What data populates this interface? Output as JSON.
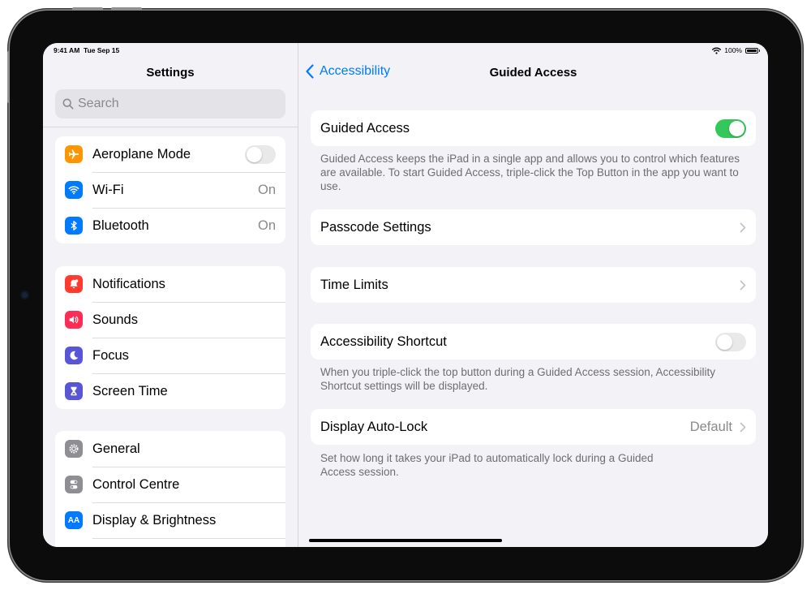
{
  "status": {
    "time": "9:41 AM",
    "date": "Tue Sep 15",
    "battery": "100%"
  },
  "sidebar": {
    "title": "Settings",
    "search_placeholder": "Search",
    "group1": [
      {
        "label": "Aeroplane Mode",
        "icon": "airplane-icon",
        "color": "#ff9500",
        "toggle": false
      },
      {
        "label": "Wi-Fi",
        "icon": "wifi-icon",
        "color": "#007aff",
        "value": "On"
      },
      {
        "label": "Bluetooth",
        "icon": "bluetooth-icon",
        "color": "#007aff",
        "value": "On"
      }
    ],
    "group2": [
      {
        "label": "Notifications",
        "icon": "bell-icon",
        "color": "#ff3b30"
      },
      {
        "label": "Sounds",
        "icon": "speaker-icon",
        "color": "#ff2d55"
      },
      {
        "label": "Focus",
        "icon": "moon-icon",
        "color": "#5856d6"
      },
      {
        "label": "Screen Time",
        "icon": "hourglass-icon",
        "color": "#5856d6"
      }
    ],
    "group3": [
      {
        "label": "General",
        "icon": "gear-icon",
        "color": "#8e8e93"
      },
      {
        "label": "Control Centre",
        "icon": "switches-icon",
        "color": "#8e8e93"
      },
      {
        "label": "Display & Brightness",
        "icon": "text-size-icon",
        "color": "#007aff",
        "icon_text": "AA"
      }
    ]
  },
  "detail": {
    "back_label": "Accessibility",
    "title": "Guided Access",
    "guided_access_label": "Guided Access",
    "guided_access_on": true,
    "guided_access_footer": "Guided Access keeps the iPad in a single app and allows you to control which features are available. To start Guided Access, triple-click the Top Button in the app you want to use.",
    "passcode_label": "Passcode Settings",
    "time_limits_label": "Time Limits",
    "shortcut_label": "Accessibility Shortcut",
    "shortcut_on": false,
    "shortcut_footer": "When you triple-click the top button during a Guided Access session, Accessibility Shortcut settings will be displayed.",
    "autolock_label": "Display Auto-Lock",
    "autolock_value": "Default",
    "autolock_footer": "Set how long it takes your iPad to automatically lock during a Guided Access session."
  },
  "colors": {
    "accent": "#007aff",
    "toggle_on": "#34c759"
  }
}
